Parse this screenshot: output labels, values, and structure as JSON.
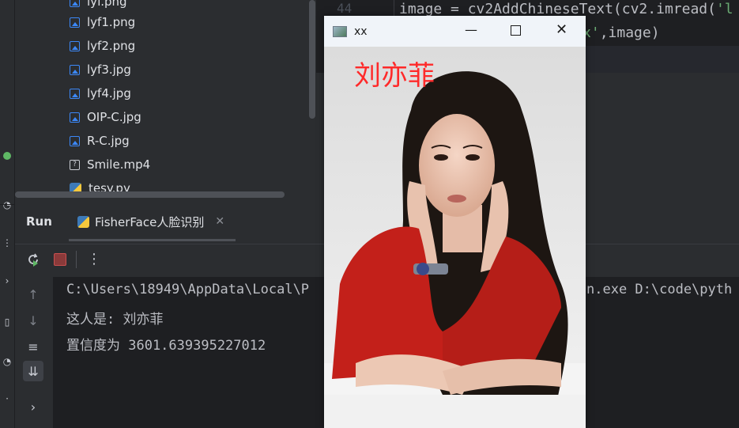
{
  "project_tree": {
    "files": [
      {
        "name": "lyf.png",
        "type": "image"
      },
      {
        "name": "lyf1.png",
        "type": "image"
      },
      {
        "name": "lyf2.png",
        "type": "image"
      },
      {
        "name": "lyf3.jpg",
        "type": "image"
      },
      {
        "name": "lyf4.jpg",
        "type": "image"
      },
      {
        "name": "OIP-C.jpg",
        "type": "image"
      },
      {
        "name": "R-C.jpg",
        "type": "image"
      },
      {
        "name": "Smile.mp4",
        "type": "unknown"
      },
      {
        "name": "tesy.py",
        "type": "python"
      }
    ]
  },
  "editor": {
    "line_number": "44",
    "code_line_1_prefix": "image = cv2AddChineseText(cv2.imread(",
    "code_line_1_string": "'l",
    "code_line_2_string": "x'",
    "code_line_2_suffix": ",image)"
  },
  "run_panel": {
    "run_label": "Run",
    "tab_label": "FisherFace人脸识别",
    "console_lines": [
      "C:\\Users\\18949\\AppData\\Local\\P",
      "这人是: 刘亦菲",
      "置信度为 3601.639395227012"
    ],
    "console_line_1_tail": "n.exe D:\\code\\pyth"
  },
  "image_window": {
    "title": "xx",
    "overlay_text": "刘亦菲",
    "overlay_color": "#ff2a2a"
  },
  "colors": {
    "accent": "#3c88f7",
    "stop_red": "#c94f4f",
    "rerun_green": "#5fb865"
  }
}
